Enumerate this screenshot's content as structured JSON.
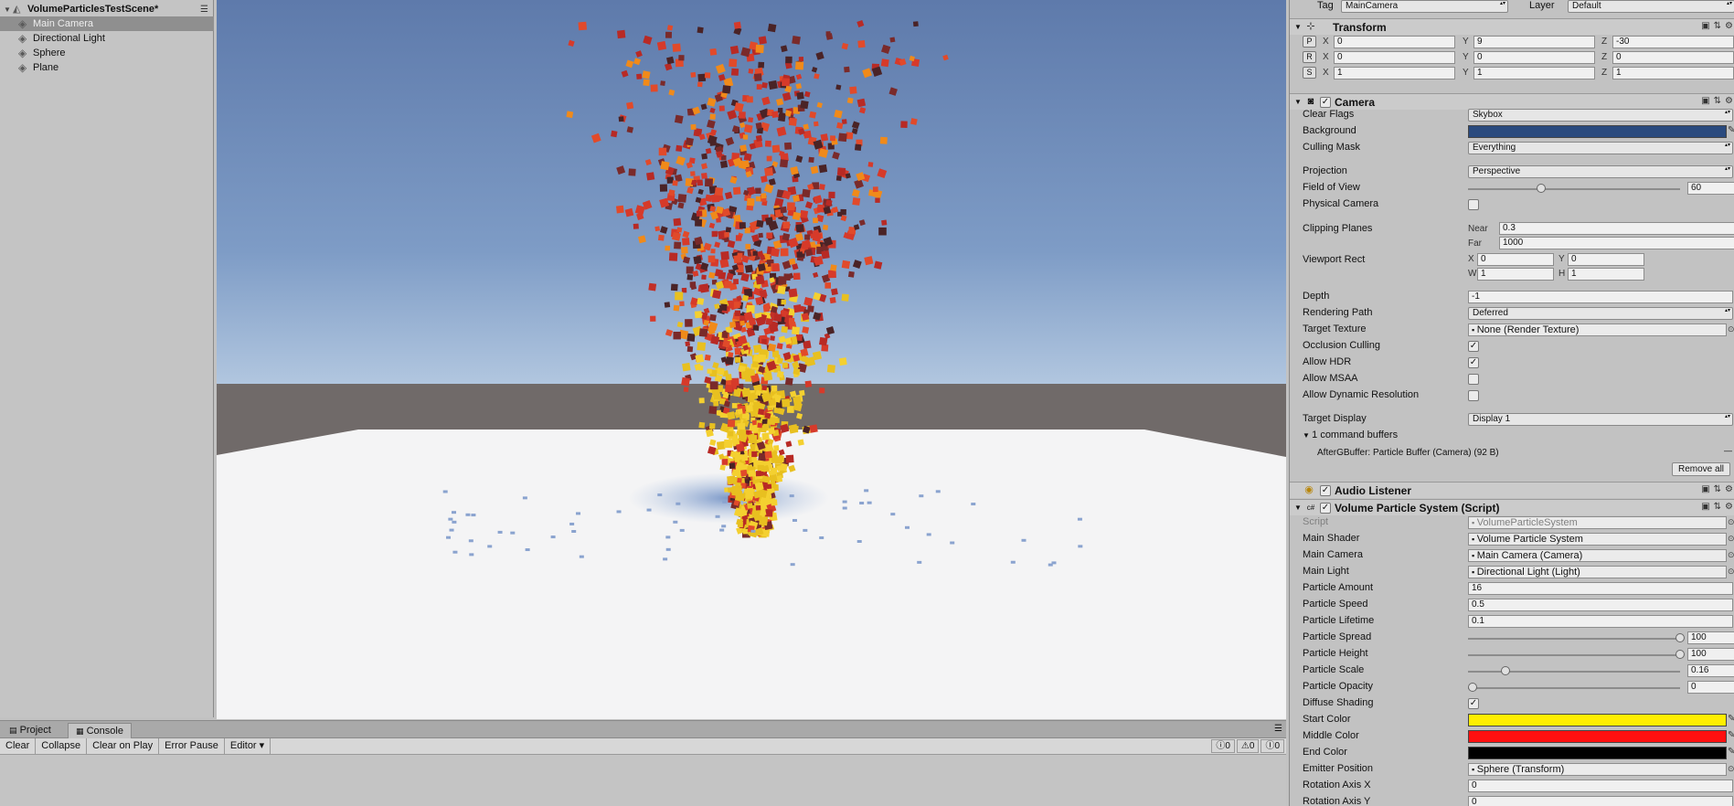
{
  "hierarchy": {
    "scene_name": "VolumeParticlesTestScene*",
    "items": [
      "Main Camera",
      "Directional Light",
      "Sphere",
      "Plane"
    ],
    "selected": "Main Camera",
    "menu_icon": "☰"
  },
  "console": {
    "tabs": [
      "Project",
      "Console"
    ],
    "active_tab": "Console",
    "buttons": [
      "Clear",
      "Collapse",
      "Clear on Play",
      "Error Pause",
      "Editor ▾"
    ],
    "counts": {
      "messages": "0",
      "warnings": "0",
      "errors": "0"
    },
    "icons": {
      "messages": "ⓘ",
      "warnings": "⚠",
      "errors": "Ⓘ"
    }
  },
  "inspector": {
    "tag_label": "Tag",
    "tag_value": "MainCamera",
    "layer_label": "Layer",
    "layer_value": "Default",
    "transform": {
      "title": "Transform",
      "rows": [
        {
          "btn": "P",
          "x": "0",
          "y": "9",
          "z": "-30"
        },
        {
          "btn": "R",
          "x": "0",
          "y": "0",
          "z": "0"
        },
        {
          "btn": "S",
          "x": "1",
          "y": "1",
          "z": "1"
        }
      ]
    },
    "camera": {
      "title": "Camera",
      "clear_flags": {
        "label": "Clear Flags",
        "value": "Skybox"
      },
      "background": {
        "label": "Background",
        "color": "#2a4a7e"
      },
      "culling_mask": {
        "label": "Culling Mask",
        "value": "Everything"
      },
      "projection": {
        "label": "Projection",
        "value": "Perspective"
      },
      "fov": {
        "label": "Field of View",
        "value": "60",
        "fraction": 0.33
      },
      "physical_camera": {
        "label": "Physical Camera",
        "checked": false
      },
      "clipping": {
        "label": "Clipping Planes",
        "near_label": "Near",
        "near": "0.3",
        "far_label": "Far",
        "far": "1000"
      },
      "viewport": {
        "label": "Viewport Rect",
        "x": "0",
        "y": "0",
        "w": "1",
        "h": "1"
      },
      "depth": {
        "label": "Depth",
        "value": "-1"
      },
      "rendering_path": {
        "label": "Rendering Path",
        "value": "Deferred"
      },
      "target_texture": {
        "label": "Target Texture",
        "value": "None (Render Texture)"
      },
      "occlusion_culling": {
        "label": "Occlusion Culling",
        "checked": true
      },
      "allow_hdr": {
        "label": "Allow HDR",
        "checked": true
      },
      "allow_msaa": {
        "label": "Allow MSAA",
        "checked": false
      },
      "allow_dynres": {
        "label": "Allow Dynamic Resolution",
        "checked": false
      },
      "target_display": {
        "label": "Target Display",
        "value": "Display 1"
      },
      "command_buffers": "1 command buffers",
      "buffer_entry": "AfterGBuffer: Particle Buffer (Camera) (92 B)",
      "remove_all": "Remove all"
    },
    "audio_listener": {
      "title": "Audio Listener"
    },
    "vps": {
      "title": "Volume Particle System (Script)",
      "script": {
        "label": "Script",
        "value": "VolumeParticleSystem"
      },
      "main_shader": {
        "label": "Main Shader",
        "value": "Volume Particle System"
      },
      "main_camera": {
        "label": "Main Camera",
        "value": "Main Camera (Camera)"
      },
      "main_light": {
        "label": "Main Light",
        "value": "Directional Light (Light)"
      },
      "amount": {
        "label": "Particle Amount",
        "value": "16"
      },
      "speed": {
        "label": "Particle Speed",
        "value": "0.5"
      },
      "lifetime": {
        "label": "Particle Lifetime",
        "value": "0.1"
      },
      "spread": {
        "label": "Particle Spread",
        "value": "100",
        "fraction": 1.0
      },
      "height": {
        "label": "Particle Height",
        "value": "100",
        "fraction": 1.0
      },
      "scale": {
        "label": "Particle Scale",
        "value": "0.16",
        "fraction": 0.16
      },
      "opacity": {
        "label": "Particle Opacity",
        "value": "0",
        "fraction": 0.0
      },
      "diffuse": {
        "label": "Diffuse Shading",
        "checked": true
      },
      "start_color": {
        "label": "Start Color",
        "color": "#ffee00"
      },
      "middle_color": {
        "label": "Middle Color",
        "color": "#ff1010"
      },
      "end_color": {
        "label": "End Color",
        "color": "#000000"
      },
      "emitter": {
        "label": "Emitter Position",
        "value": "Sphere (Transform)"
      },
      "rot_x": {
        "label": "Rotation Axis X",
        "value": "0"
      },
      "rot_y": {
        "label": "Rotation Axis Y",
        "value": "0"
      }
    }
  }
}
